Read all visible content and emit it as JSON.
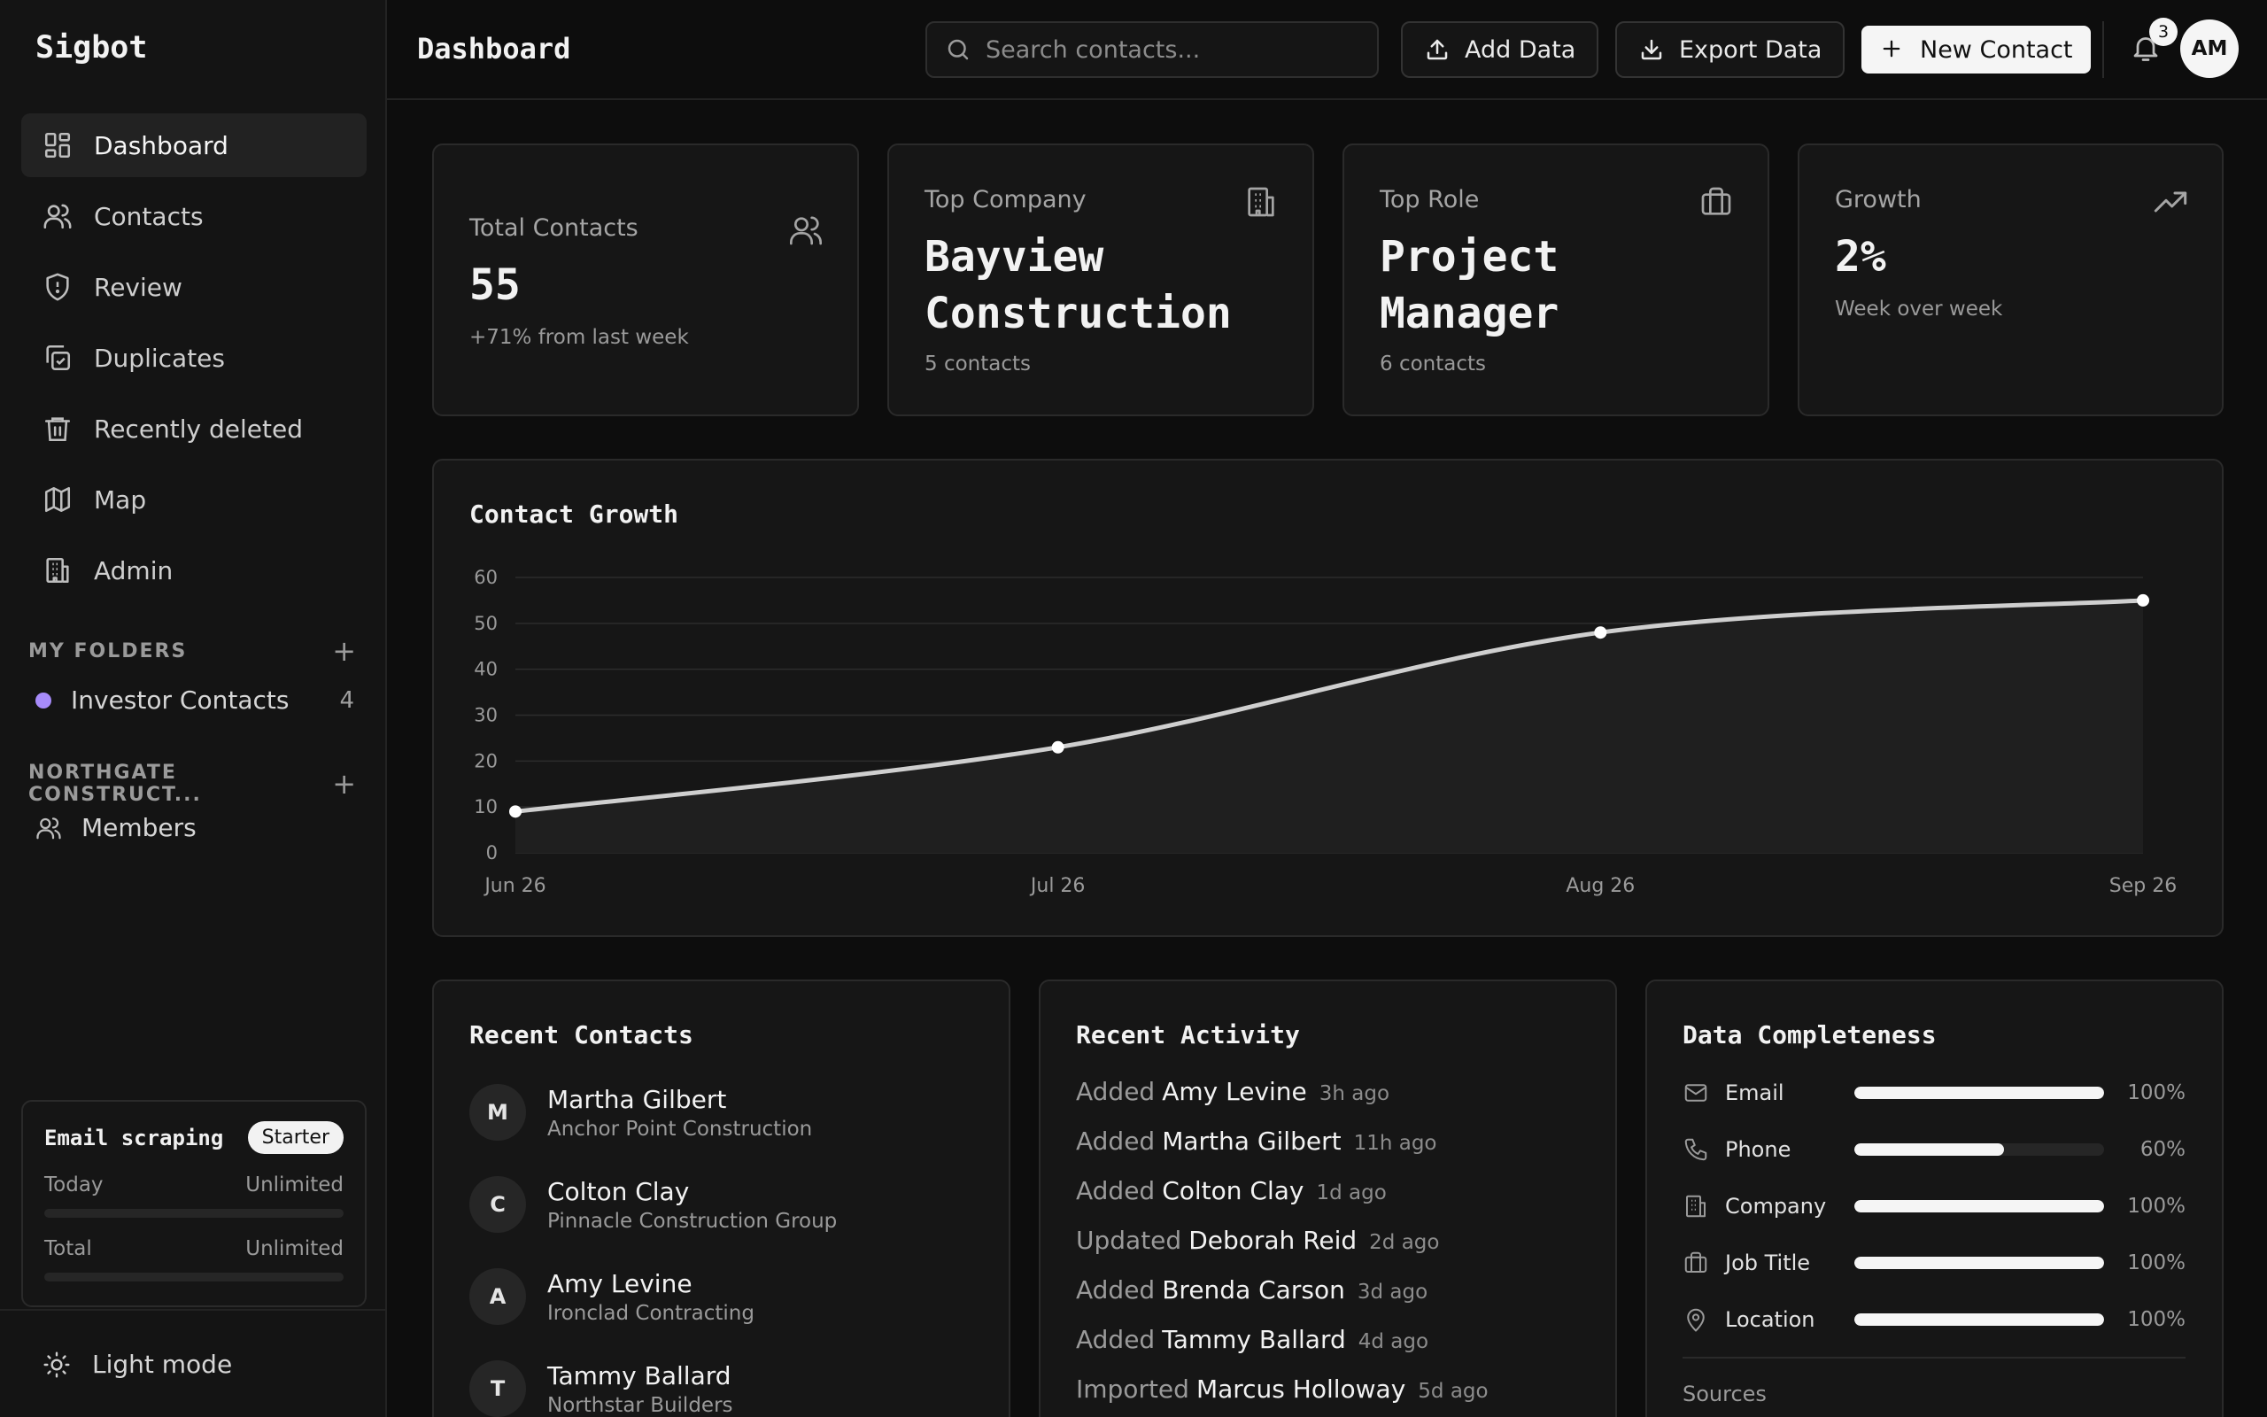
{
  "app": {
    "name": "Sigbot"
  },
  "sidebar": {
    "items": [
      {
        "label": "Dashboard",
        "icon": "dashboard-icon",
        "active": true
      },
      {
        "label": "Contacts",
        "icon": "users-icon"
      },
      {
        "label": "Review",
        "icon": "shield-icon"
      },
      {
        "label": "Duplicates",
        "icon": "copy-check-icon"
      },
      {
        "label": "Recently deleted",
        "icon": "trash-icon"
      },
      {
        "label": "Map",
        "icon": "map-icon"
      },
      {
        "label": "Admin",
        "icon": "building-icon"
      }
    ],
    "folders": {
      "heading": "MY FOLDERS",
      "items": [
        {
          "label": "Investor Contacts",
          "count": "4",
          "color": "#a78bfa"
        }
      ]
    },
    "org": {
      "heading": "NORTHGATE CONSTRUCT...",
      "members_label": "Members"
    },
    "scraping": {
      "title": "Email scraping",
      "plan": "Starter",
      "today_label": "Today",
      "today_value": "Unlimited",
      "total_label": "Total",
      "total_value": "Unlimited"
    },
    "theme_toggle": "Light mode"
  },
  "header": {
    "title": "Dashboard",
    "search_placeholder": "Search contacts...",
    "add_data": "Add Data",
    "export_data": "Export Data",
    "new_contact": "New Contact",
    "notification_count": "3",
    "avatar_initials": "AM"
  },
  "stats": {
    "total_contacts": {
      "label": "Total Contacts",
      "value": "55",
      "sub": "+71% from last week"
    },
    "top_company": {
      "label": "Top Company",
      "value_line1": "Bayview",
      "value_line2": "Construction",
      "sub": "5 contacts"
    },
    "top_role": {
      "label": "Top Role",
      "value_line1": "Project",
      "value_line2": "Manager",
      "sub": "6 contacts"
    },
    "growth": {
      "label": "Growth",
      "value": "2%",
      "sub": "Week over week"
    }
  },
  "chart_data": {
    "type": "area",
    "title": "Contact Growth",
    "x": [
      "Jun 26",
      "Jul 26",
      "Aug 26",
      "Sep 26"
    ],
    "series": [
      {
        "values": [
          9,
          23,
          48,
          55
        ]
      }
    ],
    "ylim": [
      0,
      60
    ],
    "yticks": [
      0,
      10,
      20,
      30,
      40,
      50,
      60
    ],
    "grid": true,
    "line_color": "#cfcfcf",
    "fill_color": "#1f1f1f"
  },
  "recent_contacts": {
    "title": "Recent Contacts",
    "items": [
      {
        "initial": "M",
        "name": "Martha Gilbert",
        "company": "Anchor Point Construction"
      },
      {
        "initial": "C",
        "name": "Colton Clay",
        "company": "Pinnacle Construction Group"
      },
      {
        "initial": "A",
        "name": "Amy Levine",
        "company": "Ironclad Contracting"
      },
      {
        "initial": "T",
        "name": "Tammy Ballard",
        "company": "Northstar Builders"
      }
    ]
  },
  "recent_activity": {
    "title": "Recent Activity",
    "items": [
      {
        "verb": "Added",
        "who": "Amy Levine",
        "when": "3h ago"
      },
      {
        "verb": "Added",
        "who": "Martha Gilbert",
        "when": "11h ago"
      },
      {
        "verb": "Added",
        "who": "Colton Clay",
        "when": "1d ago"
      },
      {
        "verb": "Updated",
        "who": "Deborah Reid",
        "when": "2d ago"
      },
      {
        "verb": "Added",
        "who": "Brenda Carson",
        "when": "3d ago"
      },
      {
        "verb": "Added",
        "who": "Tammy Ballard",
        "when": "4d ago"
      },
      {
        "verb": "Imported",
        "who": "Marcus Holloway",
        "when": "5d ago"
      }
    ]
  },
  "data_completeness": {
    "title": "Data Completeness",
    "items": [
      {
        "label": "Email",
        "icon": "mail-icon",
        "percent": 100,
        "percent_label": "100%"
      },
      {
        "label": "Phone",
        "icon": "phone-icon",
        "percent": 60,
        "percent_label": "60%"
      },
      {
        "label": "Company",
        "icon": "building-icon",
        "percent": 100,
        "percent_label": "100%"
      },
      {
        "label": "Job Title",
        "icon": "briefcase-icon",
        "percent": 100,
        "percent_label": "100%"
      },
      {
        "label": "Location",
        "icon": "map-pin-icon",
        "percent": 100,
        "percent_label": "100%"
      }
    ],
    "sources_label": "Sources"
  }
}
